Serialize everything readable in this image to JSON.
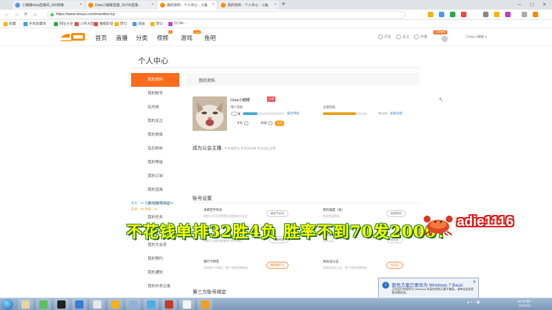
{
  "browser": {
    "tabs": [
      {
        "title": "小蝴蝶dota直播间_360搜索",
        "fav_color": "#4a9be8",
        "active": false
      },
      {
        "title": "Dota小蝴蝶直播_DOTA直播...",
        "fav_color": "#ff8a00",
        "active": false
      },
      {
        "title": "我的资料 - 个人中心 - 斗鱼",
        "fav_color": "#ff8a00",
        "active": true
      },
      {
        "title": "我的资料 - 个人中心 - 斗鱼",
        "fav_color": "#ff8a00",
        "active": false
      }
    ],
    "new_tab": "+",
    "url": "https://www.douyu.com/member/cp",
    "bookmarks": [
      {
        "label": "收藏",
        "color": "#f5b800"
      },
      {
        "label": "手机收藏夹",
        "color": "#4a9be8"
      },
      {
        "label": "网址大全",
        "color": "#2fa84f"
      },
      {
        "label": "斗罗大陆",
        "color": "#e94a4a"
      },
      {
        "label": "猫眼影视",
        "color": "#e94a4a"
      },
      {
        "label": "梦幻",
        "color": "#f5b800"
      },
      {
        "label": "漫画",
        "color": "#4a9be8"
      },
      {
        "label": "梦幻",
        "color": "#f5b800"
      },
      {
        "label": "(1) Ne...",
        "color": "#c040c0"
      }
    ]
  },
  "site": {
    "nav": [
      "首页",
      "直播",
      "分类",
      "视频",
      "游戏",
      "鱼吧"
    ],
    "nav_badges": {
      "video": "6",
      "game": "new"
    },
    "header_icons": [
      "历史",
      "关注",
      "开播"
    ],
    "promo_badge": "分享赚钱",
    "user_menu": "Dota小蝴蝶 ▾"
  },
  "ucenter": {
    "title": "个人中心",
    "menu": [
      "我的资料",
      "我的账号",
      "站内信",
      "我的关注",
      "我的贵族",
      "钻石粉丝",
      "我的等级",
      "我的订阅",
      "我的道具",
      "游戏账号绑定",
      "我的任务",
      "我的分享",
      "我的大会员",
      "我的预约",
      "我的通知",
      "我的中奖记录"
    ],
    "active_index": 0,
    "stats_line1": "鱼丸：54  鱼翅：1  鱼翅：19.55",
    "stats_line2": "成就：83  等级：41"
  },
  "profile": {
    "header": "我的资料",
    "username": "Dota小蝴蝶",
    "vip_tag": "主播",
    "user_level_label": "用户等级",
    "user_level_progress": 0.35,
    "user_level_link": "最近特权",
    "anchor_level_label": "主播等级",
    "anchor_level_progress": 0.75,
    "anchor_level_pct": "76.1%",
    "anchor_level_link": "查看详情",
    "phone_label": "手机",
    "email_label": "邮箱",
    "check_button": "认证"
  },
  "union": {
    "title": "成为公会主播",
    "subtitle": "专享推荐位  专享培训课  专业团队运营"
  },
  "account": {
    "title": "账号设置",
    "items": [
      {
        "label": "未绑定手机号",
        "desc": "绑定以后可享受更多功能和账号安全",
        "button": "绑定手机号",
        "orange": false
      },
      {
        "label": "密码强度（低）",
        "desc": "修改登录密码",
        "button": "修改密码",
        "orange": false
      },
      {
        "label": "已绑定邮箱",
        "desc": "已经可以使用邮箱进行账号找回",
        "button": "修改邮箱",
        "orange": false
      },
      {
        "label": "未实名认证",
        "desc": "实名认证",
        "button": "去认证",
        "orange": false
      },
      {
        "label": "银行卡绑定",
        "desc": "完成银行卡绑定，便于领取直播收益",
        "button": "绑定银行卡",
        "orange": true
      },
      {
        "label": "身份证认证",
        "desc": "完成身份证认证，便于领取直播收益",
        "button": "去认证",
        "orange": true
      }
    ],
    "third_party_title": "第三方账号绑定"
  },
  "overlay": {
    "caption": "不花钱单排32胜4负  胜率不到70发2000！",
    "name": "adie1116"
  },
  "notification": {
    "title": "配色方案已更改为 Windows 7 Basic",
    "body": "正在运行的程序与 Windows 的某些视觉元素不兼容。请单击此处获取详细信息。",
    "close": "✕"
  },
  "taskbar": {
    "clock_time": "20:30 周一",
    "clock_date": "2022/8/1",
    "app_colors": [
      "#e9d3a4",
      "#5bbf5b",
      "#222222",
      "#3a7ad8",
      "#e8e8e8",
      "#f2b21f",
      "#8fb0d8",
      "#4aaee8",
      "#c23a2a",
      "#f5f5f5",
      "#f0a020"
    ]
  },
  "colors": {
    "accent": "#f96d1d",
    "link": "#3b8bd8",
    "overlay_yellow": "#ffff00",
    "overlay_red": "#e21b1b"
  }
}
